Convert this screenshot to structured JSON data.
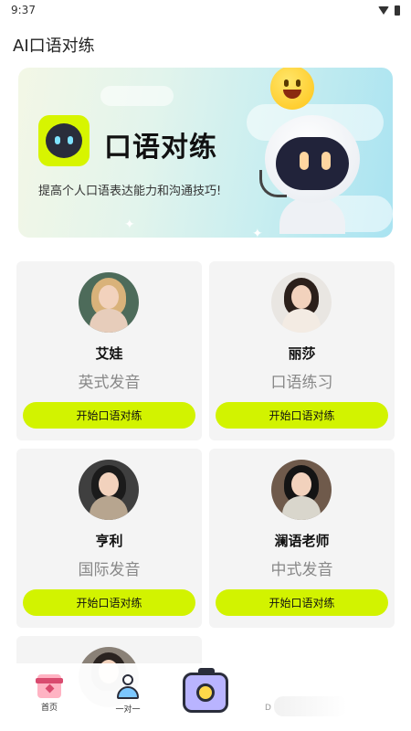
{
  "status_bar": {
    "time": "9:37"
  },
  "app": {
    "title": "AI口语对练"
  },
  "banner": {
    "title": "口语对练",
    "subtitle": "提高个人口语表达能力和沟通技巧!"
  },
  "cards": [
    {
      "name": "艾娃",
      "desc": "英式发音",
      "button": "开始口语对练"
    },
    {
      "name": "丽莎",
      "desc": "口语练习",
      "button": "开始口语对练"
    },
    {
      "name": "亨利",
      "desc": "国际发音",
      "button": "开始口语对练"
    },
    {
      "name": "澜语老师",
      "desc": "中式发音",
      "button": "开始口语对练"
    }
  ],
  "tabbar": {
    "home": "首页",
    "one_on_one": "一对一",
    "partial_label": "D"
  },
  "colors": {
    "accent": "#d2f300",
    "card_bg": "#f4f4f4"
  }
}
